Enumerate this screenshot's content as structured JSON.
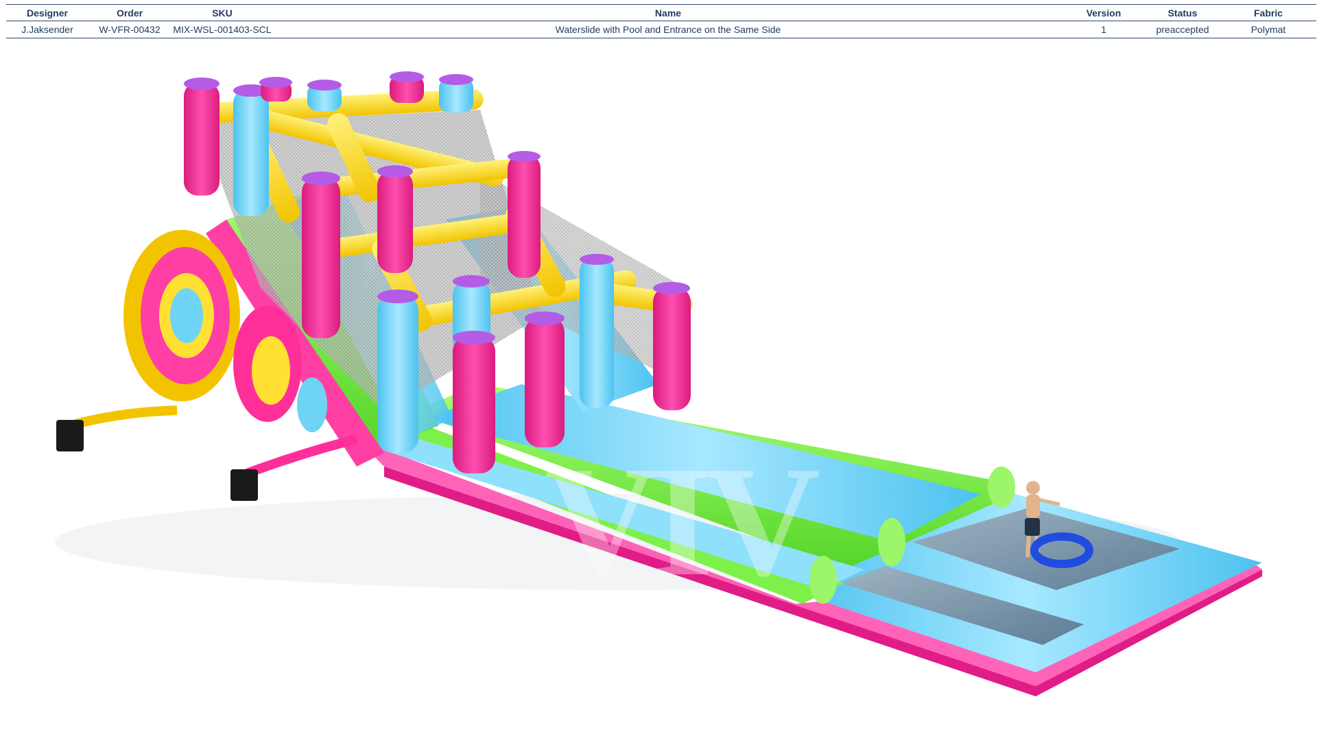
{
  "spec": {
    "headers": {
      "designer": "Designer",
      "order": "Order",
      "sku": "SKU",
      "name": "Name",
      "version": "Version",
      "status": "Status",
      "fabric": "Fabric"
    },
    "row": {
      "designer": "J.Jaksender",
      "order": "W-VFR-00432",
      "sku": "MIX-WSL-001403-SCL",
      "name": "Waterslide with Pool and Entrance on the Same Side",
      "version": "1",
      "status": "preaccepted",
      "fabric": "Polymat"
    }
  },
  "render": {
    "watermark": "VIV",
    "colors": {
      "pink": "#ff2f9a",
      "yellow": "#ffe033",
      "blue": "#6fd3f5",
      "green": "#7ef04a",
      "purple": "#b45ce6",
      "black": "#1a1a1a"
    }
  }
}
